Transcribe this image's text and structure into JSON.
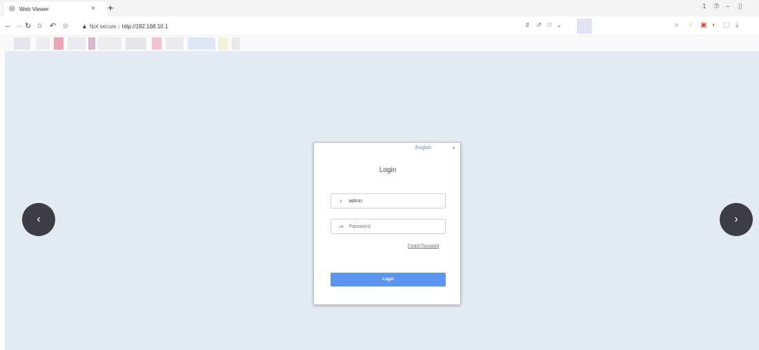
{
  "browser": {
    "tab_title": "Web Viewer",
    "tab_icon": "globe-icon",
    "tab_close": "×",
    "new_tab": "+",
    "address": {
      "security_label": "Not secure",
      "separator": "|",
      "url": "http://192.168.10.1"
    },
    "window_controls": [
      "1",
      "⑦",
      "–",
      "▯"
    ]
  },
  "login": {
    "language": "English",
    "language_caret": "▾",
    "title": "Login",
    "username_value": "admin",
    "password_placeholder": "Password",
    "forgot_password": "Forgot Password",
    "login_button": "Login"
  },
  "carousel": {
    "prev": "‹",
    "next": "›"
  },
  "colors": {
    "viewport_bg": "#e4eaf4",
    "login_button": "#5e93f0",
    "link": "#4a8fd6",
    "arrow_bg": "#3c3e44"
  }
}
